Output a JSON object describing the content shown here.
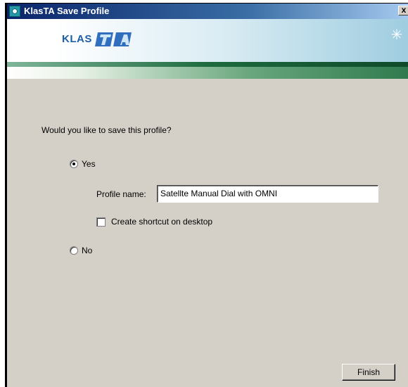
{
  "window": {
    "title": "KlasTA Save Profile"
  },
  "titlebar": {
    "close_label": "x"
  },
  "banner": {
    "logo_text": "KLAS",
    "logo_mark_icon": "ta-logo-mark",
    "right_icon": "snowflake-icon"
  },
  "form": {
    "question": "Would you like to save this profile?",
    "yes_label": "Yes",
    "yes_selected": true,
    "profile_name_label": "Profile name:",
    "profile_name_value": "Satellte Manual Dial with OMNI",
    "shortcut_label": "Create shortcut on desktop",
    "shortcut_checked": false,
    "no_label": "No",
    "no_selected": false
  },
  "buttons": {
    "finish_label": "Finish"
  }
}
